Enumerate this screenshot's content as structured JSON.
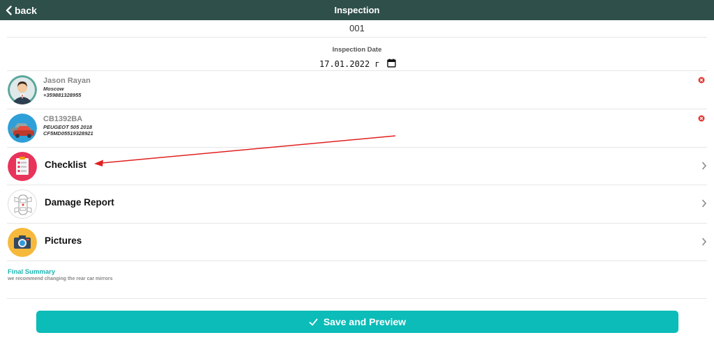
{
  "header": {
    "back_label": "back",
    "title": "Inspection"
  },
  "inspection": {
    "number": "001",
    "date_label": "Inspection Date",
    "date_value": "17.01.2022 г"
  },
  "client": {
    "name": "Jason Rayan",
    "city": "Moscow",
    "phone": "+359881328955"
  },
  "vehicle": {
    "plate": "CB1392BA",
    "model": "PEUGEOT 505 2018",
    "vin": "CF5MD05519328921"
  },
  "sections": {
    "checklist": "Checklist",
    "damage_report": "Damage Report",
    "pictures": "Pictures"
  },
  "summary": {
    "title": "Final Summary",
    "text": "we recommend changing the rear car mirrors"
  },
  "actions": {
    "save_label": "Save and Preview"
  },
  "colors": {
    "header_bg": "#2f4f4a",
    "accent": "#0bbcb8",
    "remove": "#e53935",
    "annotation": "#e02020"
  },
  "icons": {
    "back": "chevron-left-icon",
    "calendar": "calendar-icon",
    "remove": "remove-circle-icon",
    "chevron": "chevron-right-icon",
    "check": "check-icon"
  }
}
